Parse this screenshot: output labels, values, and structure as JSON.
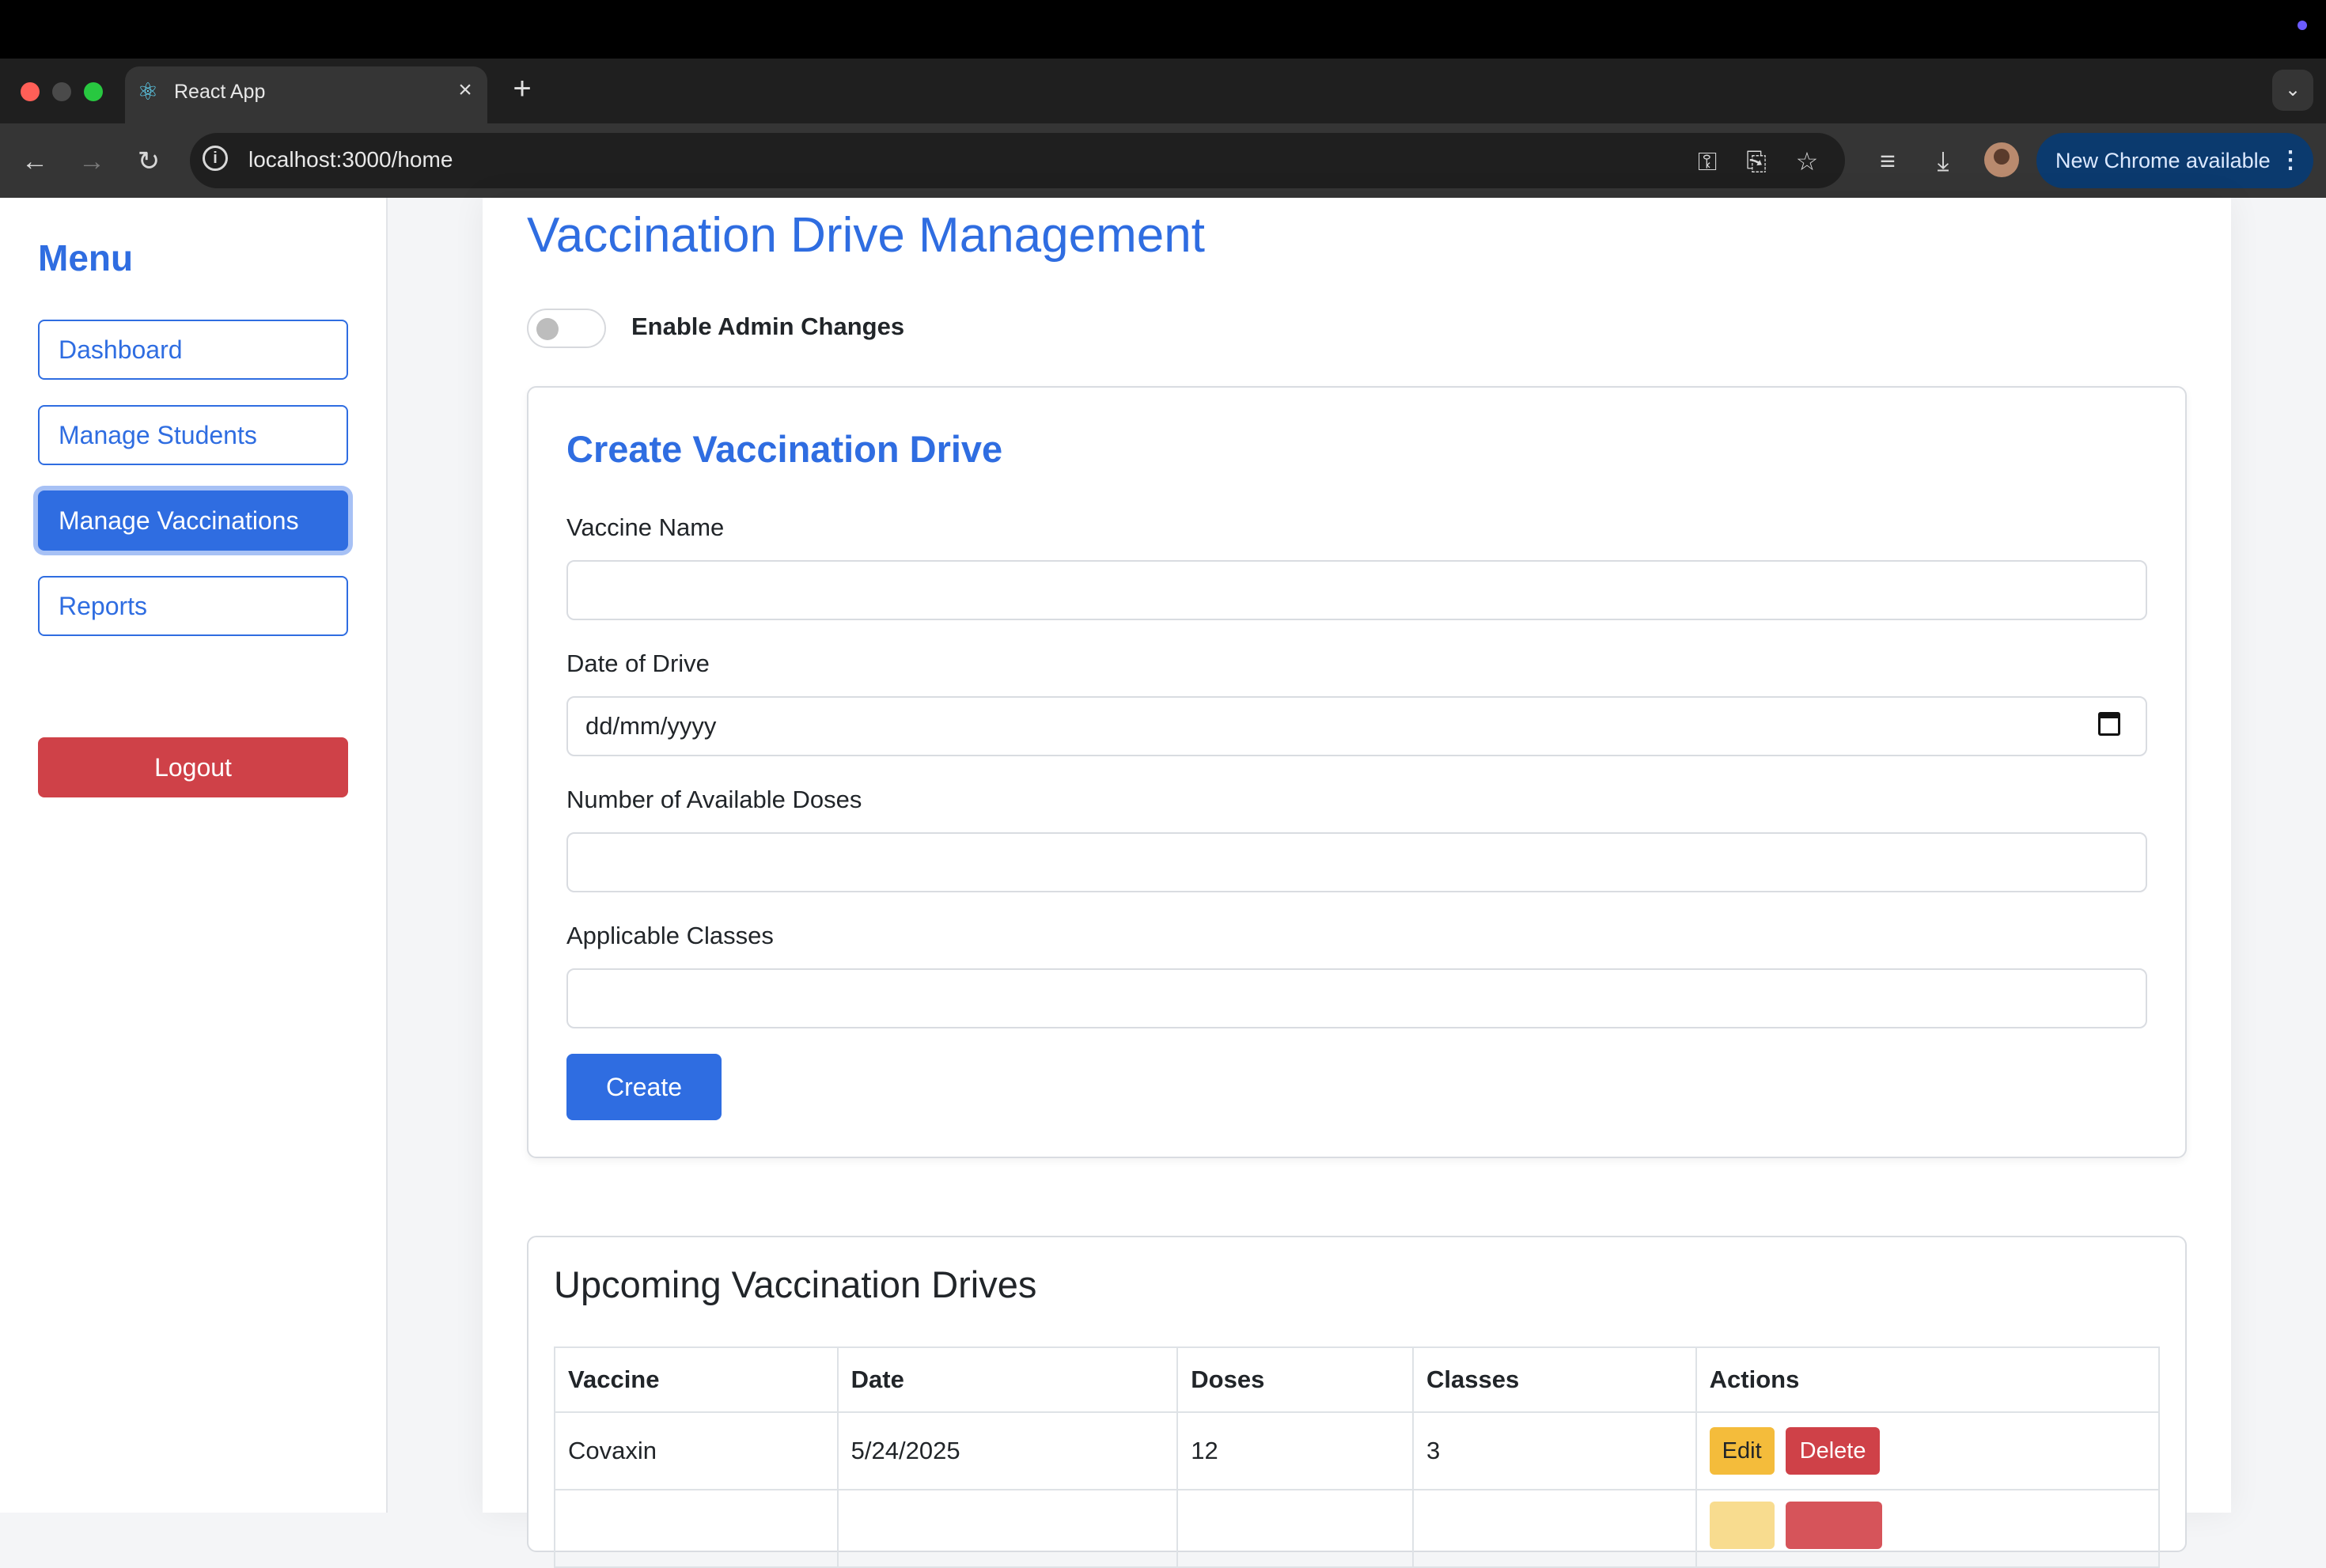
{
  "browser": {
    "tab_title": "React App",
    "url": "localhost:3000/home",
    "update_label": "New Chrome available"
  },
  "sidebar": {
    "title": "Menu",
    "items": [
      {
        "label": "Dashboard",
        "active": false
      },
      {
        "label": "Manage Students",
        "active": false
      },
      {
        "label": "Manage Vaccinations",
        "active": true
      },
      {
        "label": "Reports",
        "active": false
      }
    ],
    "logout_label": "Logout"
  },
  "main": {
    "title": "Vaccination Drive Management",
    "admin_toggle": {
      "label": "Enable Admin Changes",
      "checked": false
    },
    "form": {
      "title": "Create Vaccination Drive",
      "fields": [
        {
          "label": "Vaccine Name",
          "value": ""
        },
        {
          "label": "Date of Drive",
          "value": "dd/mm/yyyy"
        },
        {
          "label": "Number of Available Doses",
          "value": ""
        },
        {
          "label": "Applicable Classes",
          "value": ""
        }
      ],
      "submit_label": "Create"
    },
    "upcoming": {
      "title": "Upcoming Vaccination Drives",
      "columns": [
        "Vaccine",
        "Date",
        "Doses",
        "Classes",
        "Actions"
      ],
      "rows": [
        {
          "vaccine": "Covaxin",
          "date": "5/24/2025",
          "doses": "12",
          "classes": "3"
        }
      ],
      "edit_label": "Edit",
      "delete_label": "Delete"
    }
  },
  "colors": {
    "primary": "#2f6de1",
    "danger": "#cf4148",
    "warning": "#f4bc3b"
  }
}
